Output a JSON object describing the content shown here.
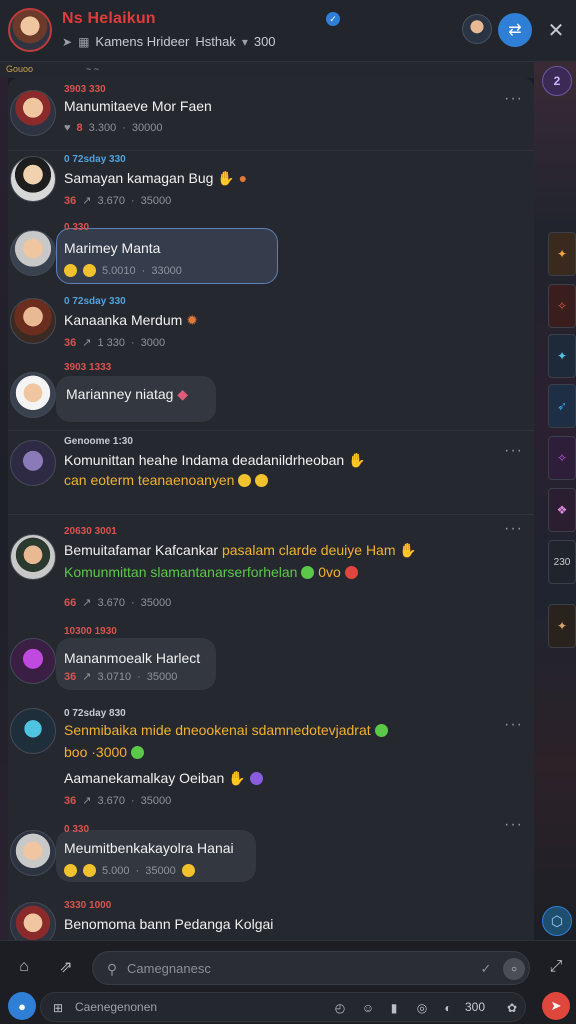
{
  "header": {
    "title": "Ns Helaikun",
    "subtitle": "Kamens Hrideer",
    "subtitle_tail": "Hsthak",
    "subtitle_count": "300",
    "close_glyph": "✕",
    "action_glyph": "⇄",
    "verified_glyph": "✓"
  },
  "strip": {
    "left": "Gouoo",
    "right": "~ ~"
  },
  "art": {
    "badge": "2",
    "tile_5_text": "230",
    "fab_glyph": "⬡"
  },
  "messages": [
    {
      "meta": "3903 330",
      "meta_color": "#d9534f",
      "text": "Manumitaeve Mor Faen",
      "stats": [
        "3.300",
        "·",
        "30000"
      ],
      "reaction": "8"
    },
    {
      "meta": "0 72sday 330",
      "meta_color": "#4fa3e0",
      "text": "Samayan kamagan Bug",
      "stats": [
        "36",
        "3.670",
        "·",
        "35000"
      ],
      "reaction": ""
    },
    {
      "meta": "0 330",
      "meta_color": "#d9534f",
      "text": "Marimey Manta",
      "stats": [
        "5.0010",
        "·",
        "33000"
      ],
      "reaction": ""
    },
    {
      "meta": "0 72sday 330",
      "meta_color": "#4fa3e0",
      "text": "Kanaanka Merdum",
      "stats": [
        "36",
        "1 330",
        "·",
        "3000"
      ],
      "reaction": ""
    },
    {
      "meta": "3903 1333",
      "meta_color": "#d9534f",
      "text": "Marianney niatag",
      "stats": [],
      "reaction": ""
    },
    {
      "meta": "Genoome 1:30",
      "meta_color": "#c8cad0",
      "text": "Komunittan heahe Indama deadanildrheoban",
      "text2": "can   eoterm teanaenoanyen",
      "stats": [],
      "reaction": ""
    },
    {
      "meta": "20630 3001",
      "meta_color": "#d9534f",
      "text": "Bemuitafamar Kafcankar",
      "text_tail": "pasalam clarde deuiye Ham",
      "text2": "Komunmittan slamantanarserforhelan",
      "text2_tail": "0vo",
      "stats": [
        "66",
        "3.670",
        "·",
        "35000"
      ],
      "reaction": ""
    },
    {
      "meta": "10300 1930",
      "meta_color": "#d9534f",
      "text": "Mananmoealk Harlect",
      "stats": [
        "36",
        "3.0710",
        "·",
        "35000"
      ],
      "reaction": ""
    },
    {
      "meta": "0 72sday 830",
      "meta_color": "#c8cad0",
      "text": "Senmibaika mide dneookenai sdamnedotevjadrat",
      "text2": "boo   ·3000",
      "text3": "Aamanekamalkay Oeiban",
      "stats": [
        "36",
        "3.670",
        "·",
        "35000"
      ],
      "reaction": ""
    },
    {
      "meta": "0 330",
      "meta_color": "#d9534f",
      "text": "Meumitbenkakayolra Hanai",
      "stats": [
        "5.000",
        "·",
        "35000"
      ],
      "reaction": ""
    },
    {
      "meta": "3330 1000",
      "meta_color": "#d9534f",
      "text": "Benomoma bann Pedanga Kolgai",
      "stats": [],
      "reaction": ""
    }
  ],
  "composer": {
    "placeholder": "Camegnanesc",
    "bar2_placeholder": "Caenegenonen",
    "count": "300",
    "mode_glyph": "○"
  },
  "colors": {
    "accent": "#2f7fd6",
    "danger": "#e0473c",
    "title": "#e23b3b",
    "green": "#5cc84a",
    "yellow": "#f2c12e"
  }
}
